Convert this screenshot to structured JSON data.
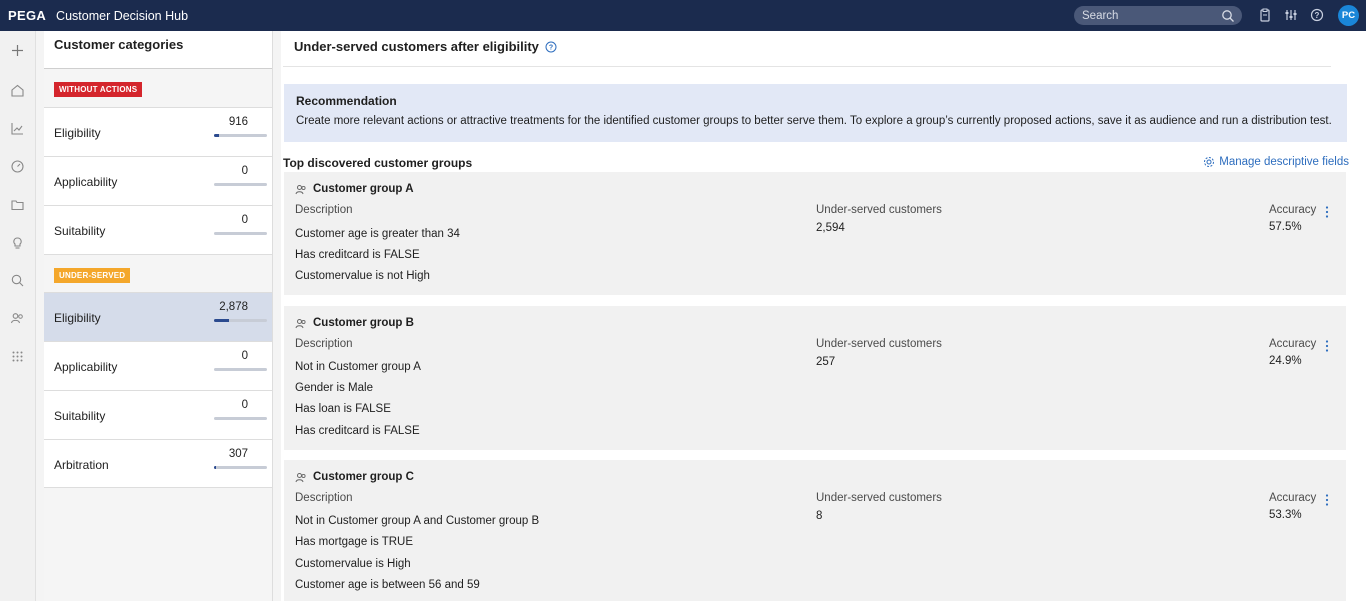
{
  "topbar": {
    "brand": "PEGA",
    "app_title": "Customer Decision Hub",
    "search_placeholder": "Search",
    "avatar_initials": "PC"
  },
  "rail": {
    "icons": [
      "plus-icon",
      "home-icon",
      "chart-icon",
      "dial-icon",
      "folder-icon",
      "lightbulb-icon",
      "search-analysis-icon",
      "people-icon",
      "grid-icon"
    ]
  },
  "categories": {
    "title": "Customer categories",
    "sections": [
      {
        "badge": "WITHOUT ACTIONS",
        "color": "#d4252c",
        "items": [
          {
            "label": "Eligibility",
            "value": "916",
            "fill": 0.1,
            "selected": false
          },
          {
            "label": "Applicability",
            "value": "0",
            "fill": 0,
            "selected": false
          },
          {
            "label": "Suitability",
            "value": "0",
            "fill": 0,
            "selected": false
          }
        ]
      },
      {
        "badge": "UNDER-SERVED",
        "color": "#f4a72b",
        "items": [
          {
            "label": "Eligibility",
            "value": "2,878",
            "fill": 0.28,
            "selected": true
          },
          {
            "label": "Applicability",
            "value": "0",
            "fill": 0,
            "selected": false
          },
          {
            "label": "Suitability",
            "value": "0",
            "fill": 0,
            "selected": false
          },
          {
            "label": "Arbitration",
            "value": "307",
            "fill": 0.03,
            "selected": false
          }
        ]
      }
    ]
  },
  "main": {
    "title": "Under-served customers after eligibility",
    "recommendation": {
      "title": "Recommendation",
      "text": "Create more relevant actions or attractive treatments for the identified customer groups to better serve them. To explore a group’s currently proposed actions, save it as audience and run a distribution test."
    },
    "groups_title": "Top discovered customer groups",
    "manage_link": "Manage descriptive fields",
    "labels": {
      "description": "Description",
      "under_served": "Under-served customers",
      "accuracy": "Accuracy"
    },
    "groups": [
      {
        "name": "Customer group A",
        "lines": [
          "Customer age is greater than 34",
          "Has creditcard is FALSE",
          "Customervalue is not High"
        ],
        "under_served": "2,594",
        "accuracy": "57.5%"
      },
      {
        "name": "Customer group B",
        "lines": [
          "Not in Customer group A",
          "Gender is Male",
          "Has loan is FALSE",
          "Has creditcard is FALSE"
        ],
        "under_served": "257",
        "accuracy": "24.9%"
      },
      {
        "name": "Customer group C",
        "lines": [
          "Not in Customer group A and Customer group B",
          "Has mortgage is TRUE",
          "Customervalue is High",
          "Customer age is between 56 and 59"
        ],
        "under_served": "8",
        "accuracy": "53.3%"
      }
    ]
  }
}
